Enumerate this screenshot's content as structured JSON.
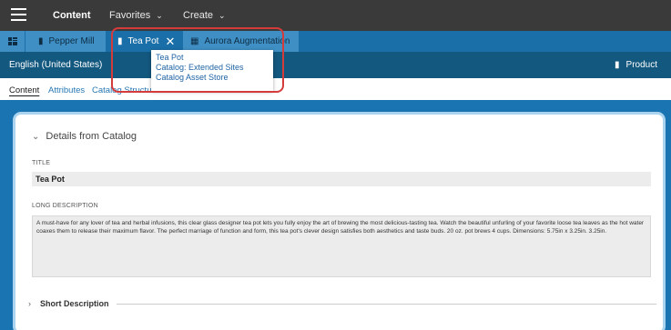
{
  "topbar": {
    "app_title": "Content",
    "menus": [
      {
        "label": "Favorites"
      },
      {
        "label": "Create"
      }
    ]
  },
  "tabs": [
    {
      "label": "Pepper Mill",
      "icon": "product-icon"
    },
    {
      "label": "Tea Pot",
      "icon": "product-icon",
      "active": true
    },
    {
      "label": "Aurora Augmentation",
      "icon": "catalog-icon"
    }
  ],
  "locale_bar": {
    "language": "English (United States)",
    "type_label": "Product"
  },
  "subtabs": [
    {
      "label": "Content",
      "active": true
    },
    {
      "label": "Attributes"
    },
    {
      "label": "Catalog Structure"
    }
  ],
  "details": {
    "section_title": "Details from Catalog",
    "title_label": "TITLE",
    "title_value": "Tea Pot",
    "long_desc_label": "LONG DESCRIPTION",
    "long_desc_value": "A must-have for any lover of tea and herbal infusions, this clear glass designer tea pot lets you fully enjoy the art of brewing the most delicious-tasting tea. Watch the beautiful unfurling of your favorite loose tea leaves as the hot water coaxes them to release their maximum flavor. The perfect marriage of function and form, this tea pot's clever design satisfies both aesthetics and taste buds. 20 oz. pot brews 4 cups. Dimensions: 5.75in x 3.25in. 3.25in.",
    "short_desc_label": "Short Description"
  },
  "tooltip": {
    "lines": [
      "Tea Pot",
      "Catalog: Extended Sites",
      "Catalog Asset Store"
    ]
  },
  "colors": {
    "topbar": "#3a3a3a",
    "tabbar": "#1a6fa8",
    "locale_bar": "#13587f",
    "highlight": "#d43b3b",
    "link": "#2779b5"
  }
}
